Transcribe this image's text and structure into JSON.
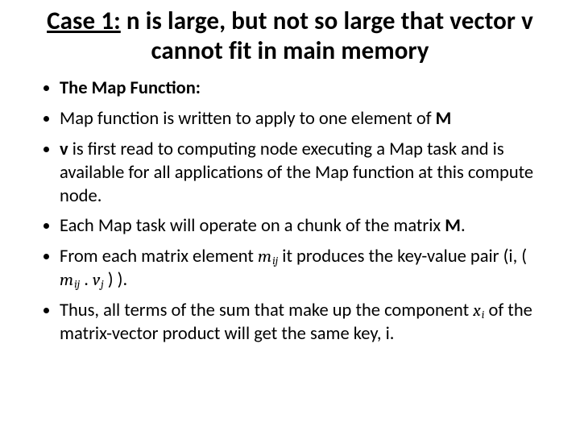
{
  "title_case_label": "Case 1:",
  "title_rest": " n is large, but not so large that vector v cannot fit in main memory",
  "bullets": {
    "b1": "The Map Function:",
    "b2_a": "Map function is written to apply to one element of ",
    "b2_M": "M",
    "b3_a": "v",
    "b3_b": " is first read to computing node executing a Map task and is available for all applications of the Map function at this compute node.",
    "b4_a": "Each Map task will operate on a chunk of the matrix ",
    "b4_M": "M",
    "b4_dot": ".",
    "b5_a": "From each matrix element ",
    "b5_m": "m",
    "b5_ij": "ij",
    "b5_b": " it produces the key-value pair (i, ( ",
    "b5_m2": "m",
    "b5_ij2": "ij",
    "b5_c": " . ",
    "b5_v": "v",
    "b5_j": "j",
    "b5_d": " ) ).",
    "b6_a": "Thus, all terms of the sum that make up the component ",
    "b6_x": "x",
    "b6_i": "i",
    "b6_b": " of the matrix-vector product will get the same key, i."
  }
}
